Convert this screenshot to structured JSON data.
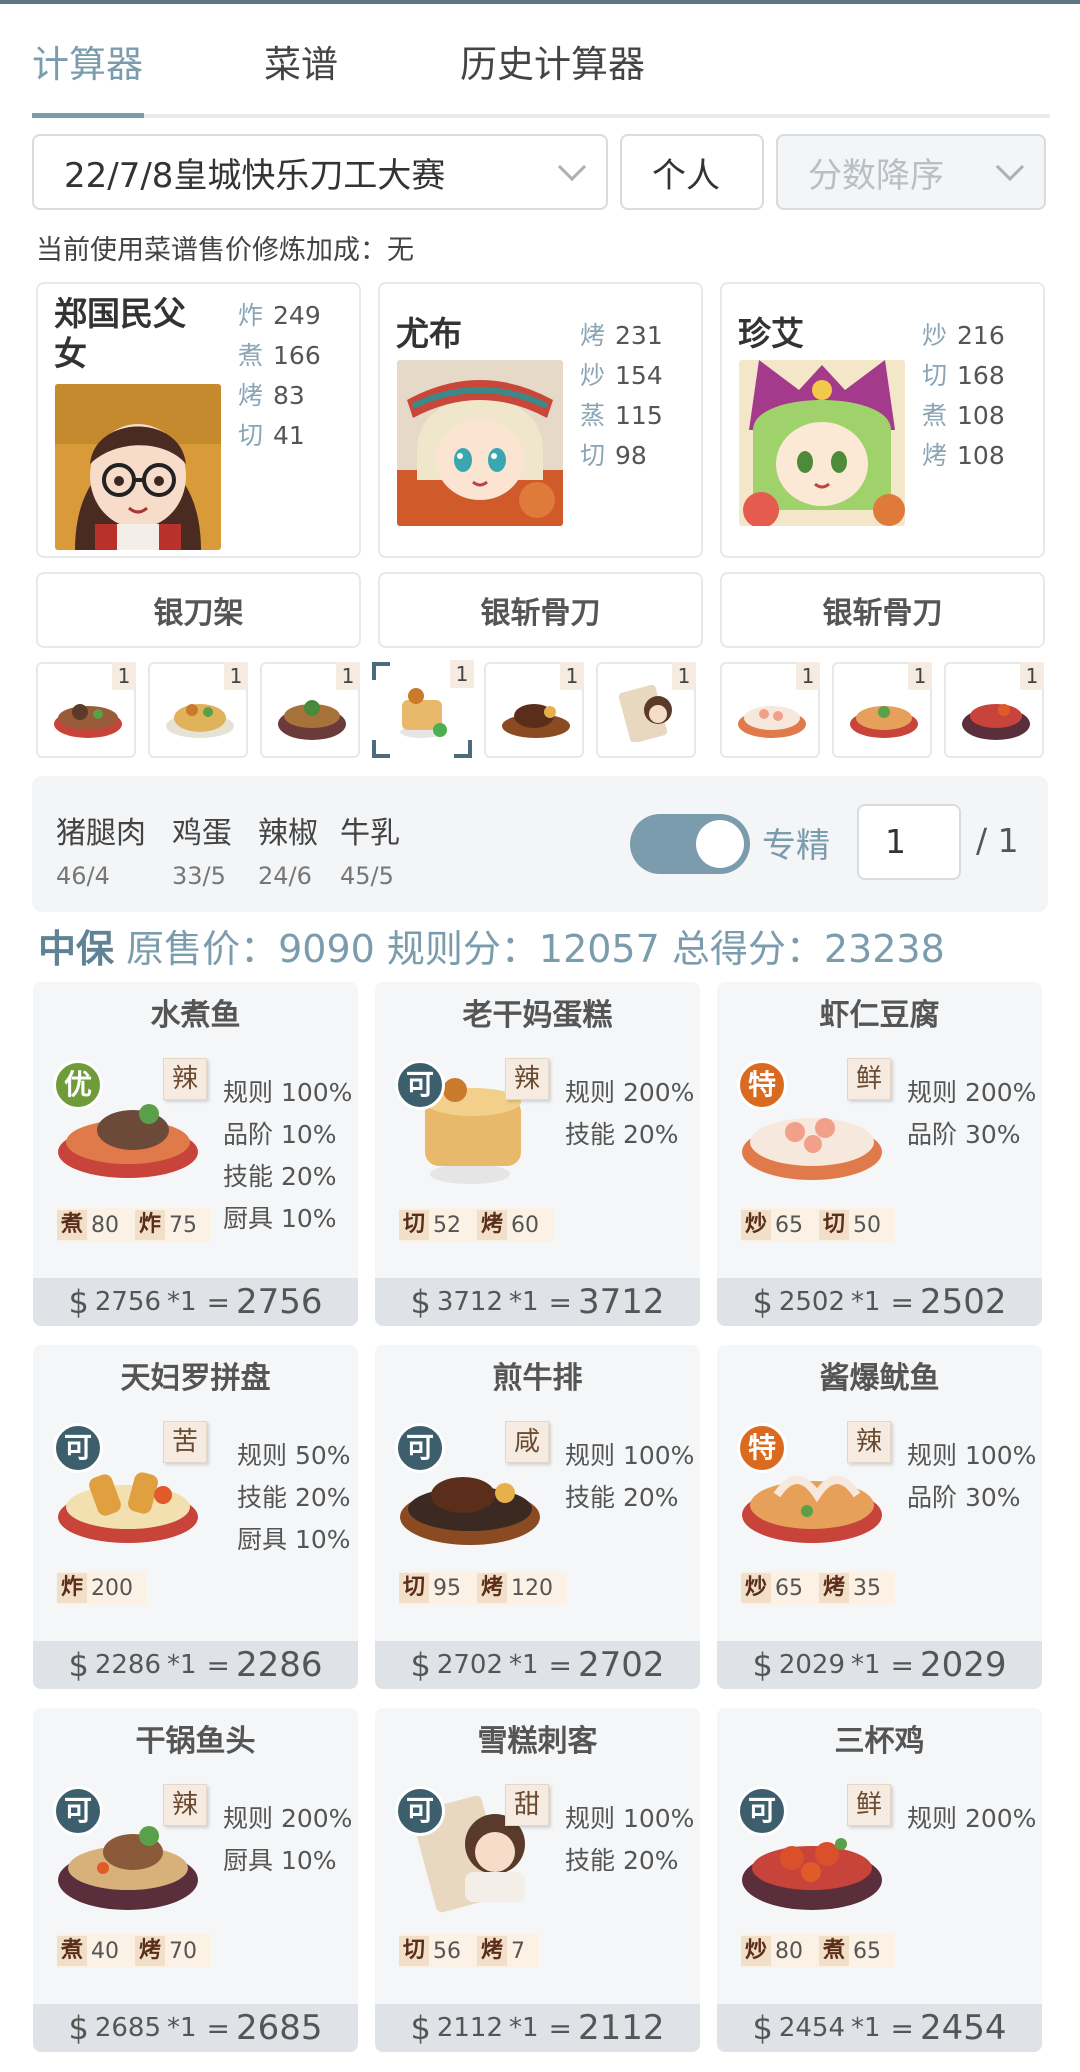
{
  "tabs": [
    "计算器",
    "菜谱",
    "历史计算器"
  ],
  "filters": {
    "contest": "22/7/8皇城快乐刀工大赛",
    "mode": "个人",
    "sort": "分数降序"
  },
  "bonus_text": "当前使用菜谱售价修炼加成：无",
  "chefs": [
    {
      "name": "郑国民父女",
      "skills": [
        {
          "k": "炸",
          "v": "249"
        },
        {
          "k": "煮",
          "v": "166"
        },
        {
          "k": "烤",
          "v": "83"
        },
        {
          "k": "切",
          "v": "41"
        }
      ],
      "equipment": "银刀架"
    },
    {
      "name": "尤布",
      "skills": [
        {
          "k": "烤",
          "v": "231"
        },
        {
          "k": "炒",
          "v": "154"
        },
        {
          "k": "蒸",
          "v": "115"
        },
        {
          "k": "切",
          "v": "98"
        }
      ],
      "equipment": "银斩骨刀"
    },
    {
      "name": "珍艾",
      "skills": [
        {
          "k": "炒",
          "v": "216"
        },
        {
          "k": "切",
          "v": "168"
        },
        {
          "k": "煮",
          "v": "108"
        },
        {
          "k": "烤",
          "v": "108"
        }
      ],
      "equipment": "银斩骨刀"
    }
  ],
  "mini_counts": [
    "1",
    "1",
    "1",
    "1",
    "1",
    "1",
    "1",
    "1",
    "1"
  ],
  "ingredients": [
    {
      "name": "猪腿肉",
      "amt": "46/4"
    },
    {
      "name": "鸡蛋",
      "amt": "33/5"
    },
    {
      "name": "辣椒",
      "amt": "24/6"
    },
    {
      "name": "牛乳",
      "amt": "45/5"
    }
  ],
  "specialize": {
    "label": "专精",
    "on": true,
    "qty": "1",
    "max": "/ 1"
  },
  "summary": {
    "grade": "中保",
    "text": "原售价：9090 规则分：12057 总得分：23238"
  },
  "dishes": [
    {
      "name": "水煮鱼",
      "grade": "优",
      "taste": "辣",
      "bonuses": [
        "规则 100%",
        "品阶 10%",
        "技能 20%",
        "厨具 10%"
      ],
      "skills": [
        {
          "t": "煮",
          "v": "80"
        },
        {
          "t": "炸",
          "v": "75"
        }
      ],
      "price": "2756",
      "mult": "*1",
      "total": "2756"
    },
    {
      "name": "老干妈蛋糕",
      "grade": "可",
      "taste": "辣",
      "bonuses": [
        "规则 200%",
        "技能 20%"
      ],
      "skills": [
        {
          "t": "切",
          "v": "52"
        },
        {
          "t": "烤",
          "v": "60"
        }
      ],
      "price": "3712",
      "mult": "*1",
      "total": "3712"
    },
    {
      "name": "虾仁豆腐",
      "grade": "特",
      "taste": "鲜",
      "bonuses": [
        "规则 200%",
        "品阶 30%"
      ],
      "skills": [
        {
          "t": "炒",
          "v": "65"
        },
        {
          "t": "切",
          "v": "50"
        }
      ],
      "price": "2502",
      "mult": "*1",
      "total": "2502"
    },
    {
      "name": "天妇罗拼盘",
      "grade": "可",
      "taste": "苦",
      "bonuses": [
        "规则 50%",
        "技能 20%",
        "厨具 10%"
      ],
      "skills": [
        {
          "t": "炸",
          "v": "200"
        }
      ],
      "price": "2286",
      "mult": "*1",
      "total": "2286"
    },
    {
      "name": "煎牛排",
      "grade": "可",
      "taste": "咸",
      "bonuses": [
        "规则 100%",
        "技能 20%"
      ],
      "skills": [
        {
          "t": "切",
          "v": "95"
        },
        {
          "t": "烤",
          "v": "120"
        }
      ],
      "price": "2702",
      "mult": "*1",
      "total": "2702"
    },
    {
      "name": "酱爆鱿鱼",
      "grade": "特",
      "taste": "辣",
      "bonuses": [
        "规则 100%",
        "品阶 30%"
      ],
      "skills": [
        {
          "t": "炒",
          "v": "65"
        },
        {
          "t": "烤",
          "v": "35"
        }
      ],
      "price": "2029",
      "mult": "*1",
      "total": "2029"
    },
    {
      "name": "干锅鱼头",
      "grade": "可",
      "taste": "辣",
      "bonuses": [
        "规则 200%",
        "厨具 10%"
      ],
      "skills": [
        {
          "t": "煮",
          "v": "40"
        },
        {
          "t": "烤",
          "v": "70"
        }
      ],
      "price": "2685",
      "mult": "*1",
      "total": "2685"
    },
    {
      "name": "雪糕刺客",
      "grade": "可",
      "taste": "甜",
      "bonuses": [
        "规则 100%",
        "技能 20%"
      ],
      "skills": [
        {
          "t": "切",
          "v": "56"
        },
        {
          "t": "烤",
          "v": "7"
        }
      ],
      "price": "2112",
      "mult": "*1",
      "total": "2112"
    },
    {
      "name": "三杯鸡",
      "grade": "可",
      "taste": "鲜",
      "bonuses": [
        "规则 200%"
      ],
      "skills": [
        {
          "t": "炒",
          "v": "80"
        },
        {
          "t": "煮",
          "v": "65"
        }
      ],
      "price": "2454",
      "mult": "*1",
      "total": "2454"
    }
  ]
}
